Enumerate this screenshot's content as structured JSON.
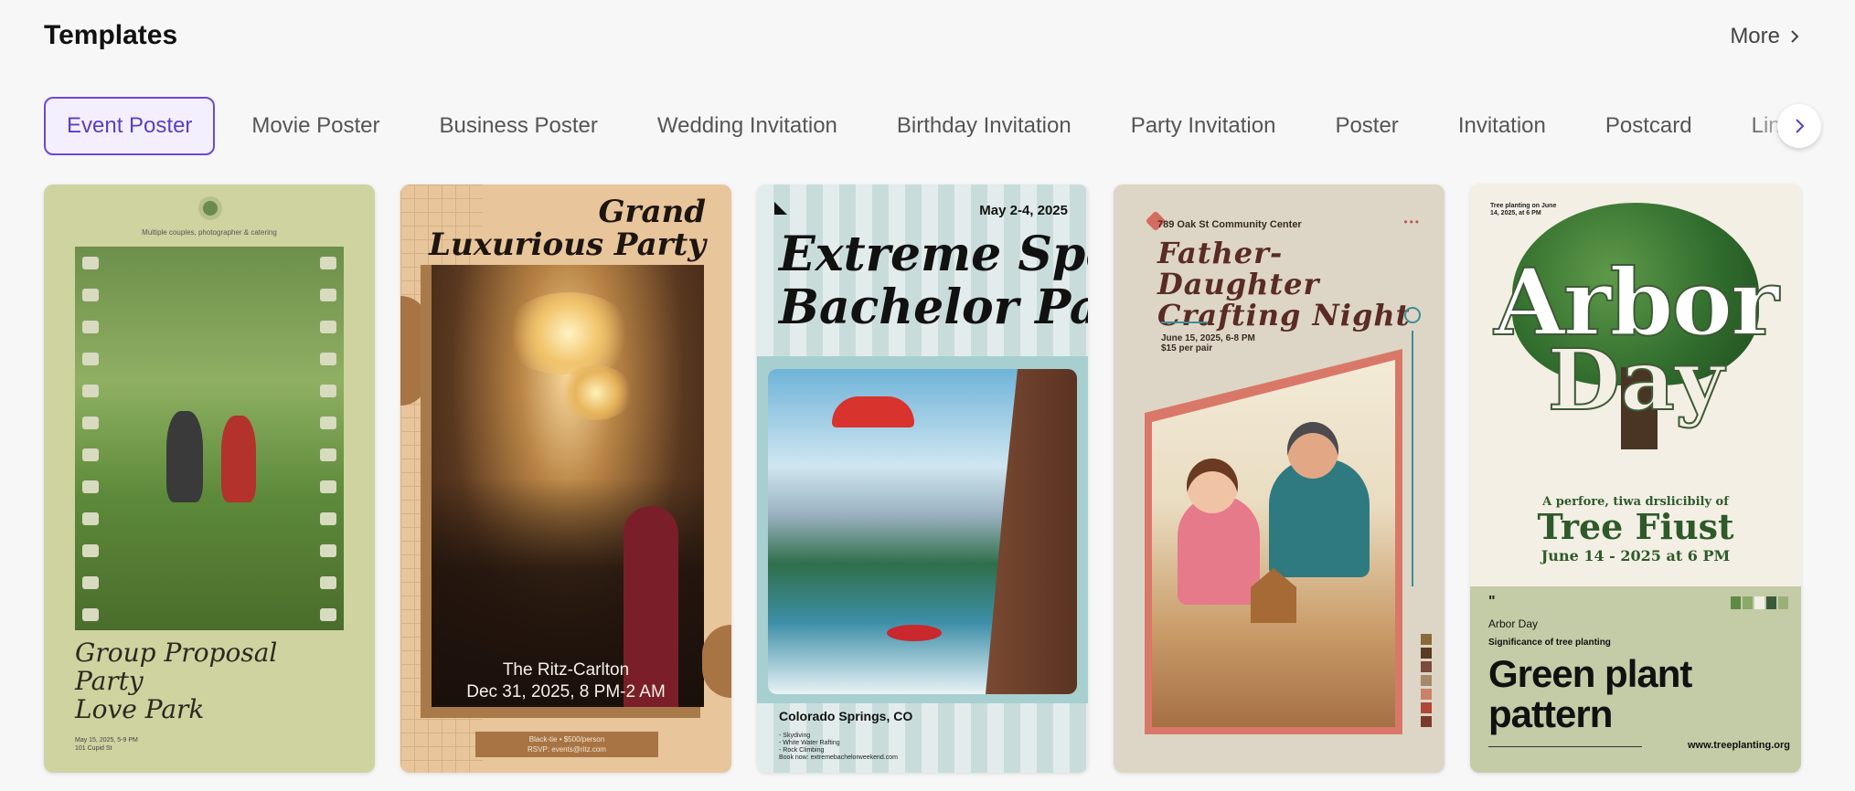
{
  "header": {
    "title": "Templates",
    "more_label": "More"
  },
  "tabs": [
    {
      "label": "Event Poster",
      "active": true
    },
    {
      "label": "Movie Poster"
    },
    {
      "label": "Business Poster"
    },
    {
      "label": "Wedding Invitation"
    },
    {
      "label": "Birthday Invitation"
    },
    {
      "label": "Party Invitation"
    },
    {
      "label": "Poster"
    },
    {
      "label": "Invitation"
    },
    {
      "label": "Postcard"
    },
    {
      "label": "Linke"
    }
  ],
  "colors": {
    "accent": "#6b4ad8",
    "accent_bg": "#f4effe",
    "page_bg": "#f7f7f8"
  },
  "icons": {
    "more": "chevron-right-icon",
    "next": "chevron-right-icon"
  },
  "cards": [
    {
      "subtitle": "Multiple couples, photographer & catering",
      "title_lines": [
        "Group Proposal",
        "Party",
        "Love Park"
      ],
      "fine_lines": [
        "May 15, 2025, 5-9 PM",
        "101 Cupid St"
      ]
    },
    {
      "title_lines": [
        "Grand",
        "Luxurious Party"
      ],
      "caption_lines": [
        "The Ritz-Carlton",
        "Dec 31, 2025, 8 PM-2 AM"
      ],
      "rsvp_lines": [
        "Black-tie • $500/person",
        "RSVP: events@ritz.com"
      ]
    },
    {
      "date": "May 2-4, 2025",
      "title_lines": [
        "Extreme Sports",
        "Bachelor Party"
      ],
      "location": "Colorado Springs, CO",
      "list": [
        "- Skydiving",
        "- White Water Rafting",
        "- Rock Climbing",
        "Book now: extremebachelorweekend.com"
      ]
    },
    {
      "venue": "789 Oak St Community Center",
      "dots": "•••",
      "title_lines": [
        "Father-Daughter",
        "Crafting Night"
      ],
      "when_lines": [
        "June 15, 2025, 6-8 PM",
        "$15 per pair"
      ]
    },
    {
      "small_lines": [
        "Tree planting on June",
        "14, 2025, at 6 PM"
      ],
      "word1": "Arbor",
      "word2": "Day",
      "lead": "A perfore, tiwa drslicibily of",
      "big": "Tree Fiust",
      "date": "June 14 - 2025 at 6 PM",
      "quote": "\"",
      "label1": "Arbor Day",
      "label2": "Significance of tree planting",
      "headline_lines": [
        "Green plant",
        "pattern"
      ],
      "url": "www.treeplanting.org"
    }
  ]
}
